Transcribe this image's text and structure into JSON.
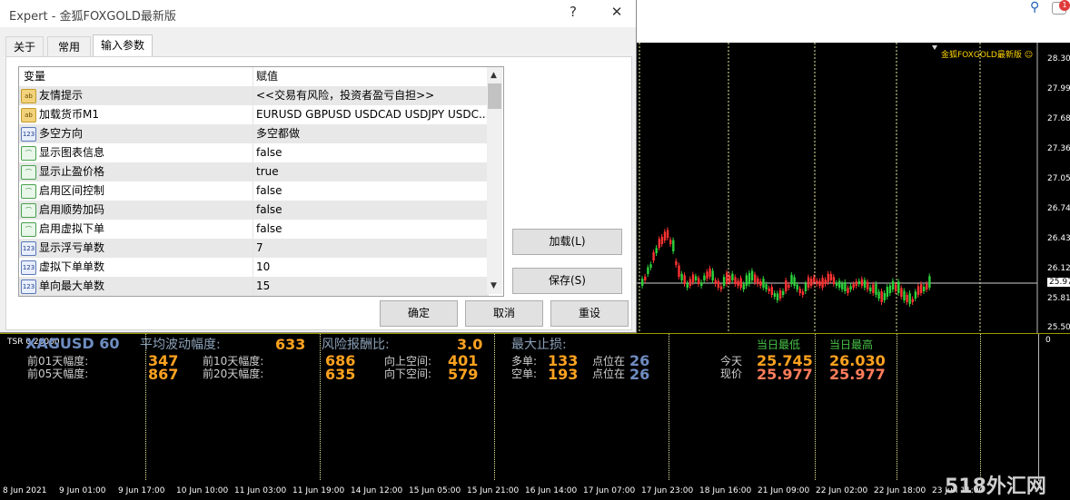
{
  "window": {
    "title": "Expert - 金狐FOXGOLD最新版",
    "help": "?",
    "close": "✕"
  },
  "tabs": [
    {
      "label": "关于"
    },
    {
      "label": "常用"
    },
    {
      "label": "输入参数"
    }
  ],
  "grid": {
    "col_var": "变量",
    "col_val": "赋值",
    "rows": [
      {
        "icon": "ab",
        "name": "友情提示",
        "value": "<<交易有风险，投资者盈亏自担>>"
      },
      {
        "icon": "ab",
        "name": "加载货币M1",
        "value": "EURUSD GBPUSD USDCAD USDJPY USDC..."
      },
      {
        "icon": "123",
        "name": "多空方向",
        "value": "多空都做"
      },
      {
        "icon": "bool",
        "name": "显示图表信息",
        "value": "false"
      },
      {
        "icon": "bool",
        "name": "显示止盈价格",
        "value": "true"
      },
      {
        "icon": "bool",
        "name": "启用区间控制",
        "value": "false"
      },
      {
        "icon": "bool",
        "name": "启用顺势加码",
        "value": "false"
      },
      {
        "icon": "bool",
        "name": "启用虚拟下单",
        "value": "false"
      },
      {
        "icon": "123",
        "name": "显示浮亏单数",
        "value": "7"
      },
      {
        "icon": "123",
        "name": "虚拟下单单数",
        "value": "10"
      },
      {
        "icon": "123",
        "name": "单向最大单数",
        "value": "15"
      }
    ]
  },
  "buttons": {
    "load": "加载(L)",
    "save": "保存(S)",
    "ok": "确定",
    "cancel": "取消",
    "reset": "重设"
  },
  "chart": {
    "ea_label": "金狐FOXGOLD最新版 ☺",
    "prices": [
      "28.300",
      "27.990",
      "27.680",
      "27.365",
      "27.055",
      "26.745",
      "26.435",
      "26.125",
      "25.977",
      "25.815",
      "25.505"
    ],
    "indicator_zero": "0",
    "indicator_name": "TSR 0.20000",
    "time_labels": [
      "8 Jun 2021",
      "9 Jun 01:00",
      "9 Jun 17:00",
      "10 Jun 10:00",
      "11 Jun 03:00",
      "11 Jun 19:00",
      "14 Jun 12:00",
      "15 Jun 05:00",
      "15 Jun 21:00",
      "16 Jun 14:00",
      "17 Jun 07:00",
      "17 Jun 23:00",
      "18 Jun 16:00",
      "21 Jun 09:00",
      "22 Jun 02:00",
      "22 Jun 18:00",
      "23 Jun 11:00"
    ]
  },
  "stats": {
    "symbol": "XAGUSD 60",
    "avg_vol_label": "平均波动幅度:",
    "avg_vol": "633",
    "risk_label": "风险报酬比:",
    "risk": "3.0",
    "maxsl_label": "最大止损:",
    "d1_label": "前01天幅度:",
    "d1": "347",
    "d5_label": "前05天幅度:",
    "d5": "867",
    "d10_label": "前10天幅度:",
    "d10": "686",
    "d20_label": "前20天幅度:",
    "d20": "635",
    "up_label": "向上空间:",
    "up": "401",
    "down_label": "向下空间:",
    "down": "579",
    "long_label": "多单:",
    "long": "133",
    "short_label": "空单:",
    "short": "193",
    "pos1_label": "点位在",
    "pos1": "26",
    "pos2_label": "点位在",
    "pos2": "26",
    "today_label": "今天",
    "now_label": "现价",
    "low_label": "当日最低",
    "high_label": "当日最高",
    "today_low": "25.745",
    "today_high": "26.030",
    "now_low": "25.977",
    "now_high": "25.977"
  },
  "toolbar": {
    "badge": "1"
  },
  "watermark": "518外汇网"
}
